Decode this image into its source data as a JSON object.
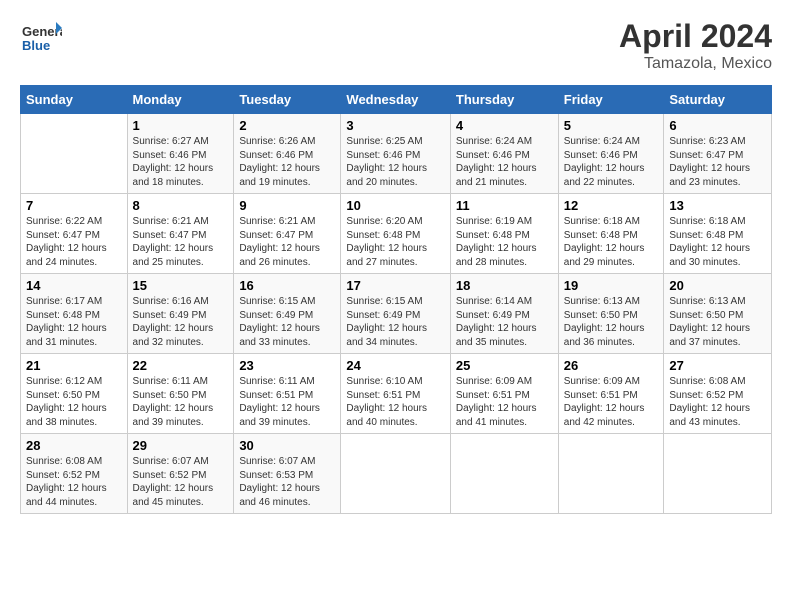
{
  "logo": {
    "general": "General",
    "blue": "Blue"
  },
  "title": "April 2024",
  "subtitle": "Tamazola, Mexico",
  "days_of_week": [
    "Sunday",
    "Monday",
    "Tuesday",
    "Wednesday",
    "Thursday",
    "Friday",
    "Saturday"
  ],
  "weeks": [
    [
      {
        "num": "",
        "sunrise": "",
        "sunset": "",
        "daylight": ""
      },
      {
        "num": "1",
        "sunrise": "Sunrise: 6:27 AM",
        "sunset": "Sunset: 6:46 PM",
        "daylight": "Daylight: 12 hours and 18 minutes."
      },
      {
        "num": "2",
        "sunrise": "Sunrise: 6:26 AM",
        "sunset": "Sunset: 6:46 PM",
        "daylight": "Daylight: 12 hours and 19 minutes."
      },
      {
        "num": "3",
        "sunrise": "Sunrise: 6:25 AM",
        "sunset": "Sunset: 6:46 PM",
        "daylight": "Daylight: 12 hours and 20 minutes."
      },
      {
        "num": "4",
        "sunrise": "Sunrise: 6:24 AM",
        "sunset": "Sunset: 6:46 PM",
        "daylight": "Daylight: 12 hours and 21 minutes."
      },
      {
        "num": "5",
        "sunrise": "Sunrise: 6:24 AM",
        "sunset": "Sunset: 6:46 PM",
        "daylight": "Daylight: 12 hours and 22 minutes."
      },
      {
        "num": "6",
        "sunrise": "Sunrise: 6:23 AM",
        "sunset": "Sunset: 6:47 PM",
        "daylight": "Daylight: 12 hours and 23 minutes."
      }
    ],
    [
      {
        "num": "7",
        "sunrise": "Sunrise: 6:22 AM",
        "sunset": "Sunset: 6:47 PM",
        "daylight": "Daylight: 12 hours and 24 minutes."
      },
      {
        "num": "8",
        "sunrise": "Sunrise: 6:21 AM",
        "sunset": "Sunset: 6:47 PM",
        "daylight": "Daylight: 12 hours and 25 minutes."
      },
      {
        "num": "9",
        "sunrise": "Sunrise: 6:21 AM",
        "sunset": "Sunset: 6:47 PM",
        "daylight": "Daylight: 12 hours and 26 minutes."
      },
      {
        "num": "10",
        "sunrise": "Sunrise: 6:20 AM",
        "sunset": "Sunset: 6:48 PM",
        "daylight": "Daylight: 12 hours and 27 minutes."
      },
      {
        "num": "11",
        "sunrise": "Sunrise: 6:19 AM",
        "sunset": "Sunset: 6:48 PM",
        "daylight": "Daylight: 12 hours and 28 minutes."
      },
      {
        "num": "12",
        "sunrise": "Sunrise: 6:18 AM",
        "sunset": "Sunset: 6:48 PM",
        "daylight": "Daylight: 12 hours and 29 minutes."
      },
      {
        "num": "13",
        "sunrise": "Sunrise: 6:18 AM",
        "sunset": "Sunset: 6:48 PM",
        "daylight": "Daylight: 12 hours and 30 minutes."
      }
    ],
    [
      {
        "num": "14",
        "sunrise": "Sunrise: 6:17 AM",
        "sunset": "Sunset: 6:48 PM",
        "daylight": "Daylight: 12 hours and 31 minutes."
      },
      {
        "num": "15",
        "sunrise": "Sunrise: 6:16 AM",
        "sunset": "Sunset: 6:49 PM",
        "daylight": "Daylight: 12 hours and 32 minutes."
      },
      {
        "num": "16",
        "sunrise": "Sunrise: 6:15 AM",
        "sunset": "Sunset: 6:49 PM",
        "daylight": "Daylight: 12 hours and 33 minutes."
      },
      {
        "num": "17",
        "sunrise": "Sunrise: 6:15 AM",
        "sunset": "Sunset: 6:49 PM",
        "daylight": "Daylight: 12 hours and 34 minutes."
      },
      {
        "num": "18",
        "sunrise": "Sunrise: 6:14 AM",
        "sunset": "Sunset: 6:49 PM",
        "daylight": "Daylight: 12 hours and 35 minutes."
      },
      {
        "num": "19",
        "sunrise": "Sunrise: 6:13 AM",
        "sunset": "Sunset: 6:50 PM",
        "daylight": "Daylight: 12 hours and 36 minutes."
      },
      {
        "num": "20",
        "sunrise": "Sunrise: 6:13 AM",
        "sunset": "Sunset: 6:50 PM",
        "daylight": "Daylight: 12 hours and 37 minutes."
      }
    ],
    [
      {
        "num": "21",
        "sunrise": "Sunrise: 6:12 AM",
        "sunset": "Sunset: 6:50 PM",
        "daylight": "Daylight: 12 hours and 38 minutes."
      },
      {
        "num": "22",
        "sunrise": "Sunrise: 6:11 AM",
        "sunset": "Sunset: 6:50 PM",
        "daylight": "Daylight: 12 hours and 39 minutes."
      },
      {
        "num": "23",
        "sunrise": "Sunrise: 6:11 AM",
        "sunset": "Sunset: 6:51 PM",
        "daylight": "Daylight: 12 hours and 39 minutes."
      },
      {
        "num": "24",
        "sunrise": "Sunrise: 6:10 AM",
        "sunset": "Sunset: 6:51 PM",
        "daylight": "Daylight: 12 hours and 40 minutes."
      },
      {
        "num": "25",
        "sunrise": "Sunrise: 6:09 AM",
        "sunset": "Sunset: 6:51 PM",
        "daylight": "Daylight: 12 hours and 41 minutes."
      },
      {
        "num": "26",
        "sunrise": "Sunrise: 6:09 AM",
        "sunset": "Sunset: 6:51 PM",
        "daylight": "Daylight: 12 hours and 42 minutes."
      },
      {
        "num": "27",
        "sunrise": "Sunrise: 6:08 AM",
        "sunset": "Sunset: 6:52 PM",
        "daylight": "Daylight: 12 hours and 43 minutes."
      }
    ],
    [
      {
        "num": "28",
        "sunrise": "Sunrise: 6:08 AM",
        "sunset": "Sunset: 6:52 PM",
        "daylight": "Daylight: 12 hours and 44 minutes."
      },
      {
        "num": "29",
        "sunrise": "Sunrise: 6:07 AM",
        "sunset": "Sunset: 6:52 PM",
        "daylight": "Daylight: 12 hours and 45 minutes."
      },
      {
        "num": "30",
        "sunrise": "Sunrise: 6:07 AM",
        "sunset": "Sunset: 6:53 PM",
        "daylight": "Daylight: 12 hours and 46 minutes."
      },
      {
        "num": "",
        "sunrise": "",
        "sunset": "",
        "daylight": ""
      },
      {
        "num": "",
        "sunrise": "",
        "sunset": "",
        "daylight": ""
      },
      {
        "num": "",
        "sunrise": "",
        "sunset": "",
        "daylight": ""
      },
      {
        "num": "",
        "sunrise": "",
        "sunset": "",
        "daylight": ""
      }
    ]
  ]
}
